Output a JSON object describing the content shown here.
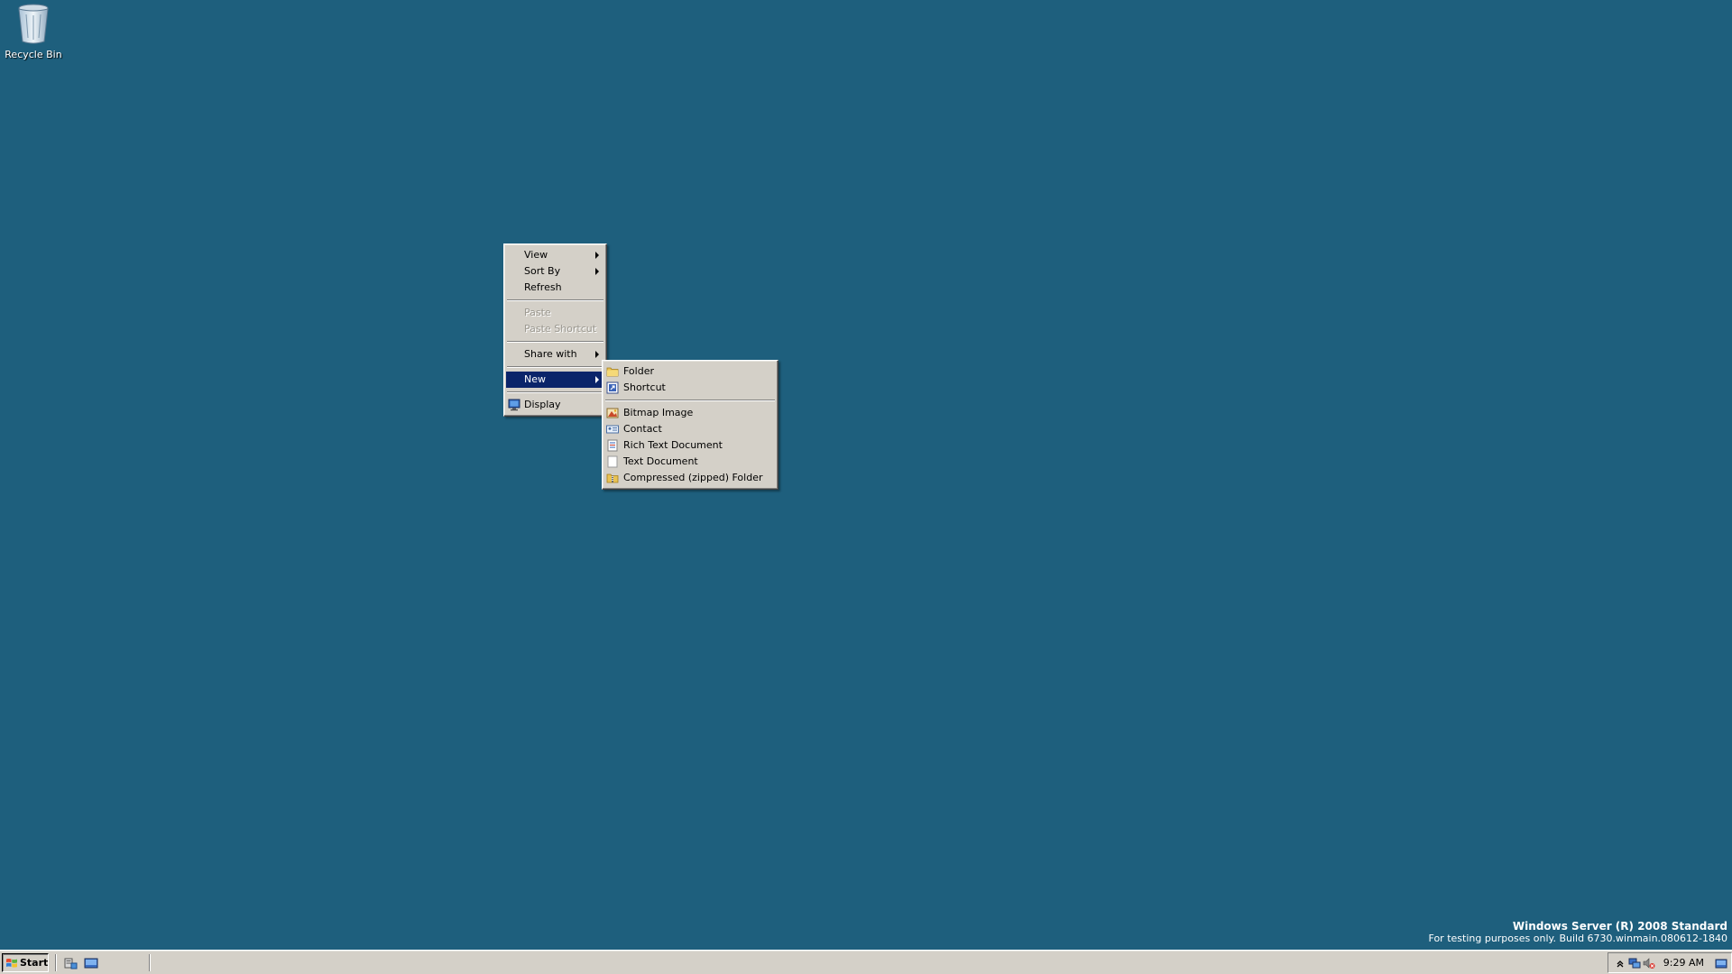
{
  "desktop": {
    "icons": [
      {
        "label": "Recycle Bin"
      }
    ]
  },
  "context_menu": {
    "items": [
      {
        "label": "View",
        "has_submenu": true
      },
      {
        "label": "Sort By",
        "has_submenu": true
      },
      {
        "label": "Refresh"
      },
      {
        "label": "Paste",
        "disabled": true
      },
      {
        "label": "Paste Shortcut",
        "disabled": true
      },
      {
        "label": "Share with",
        "has_submenu": true
      },
      {
        "label": "New",
        "has_submenu": true,
        "highlighted": true
      },
      {
        "label": "Display",
        "icon": "display-icon"
      }
    ]
  },
  "new_submenu": {
    "items": [
      {
        "label": "Folder",
        "icon": "folder-icon"
      },
      {
        "label": "Shortcut",
        "icon": "shortcut-icon"
      },
      {
        "label": "Bitmap Image",
        "icon": "bitmap-icon"
      },
      {
        "label": "Contact",
        "icon": "contact-icon"
      },
      {
        "label": "Rich Text Document",
        "icon": "rich-text-icon"
      },
      {
        "label": "Text Document",
        "icon": "text-document-icon"
      },
      {
        "label": "Compressed (zipped) Folder",
        "icon": "zipped-folder-icon"
      }
    ]
  },
  "watermark": {
    "line1": "Windows Server (R) 2008 Standard",
    "line2": "For testing purposes only. Build 6730.winmain.080612-1840"
  },
  "taskbar": {
    "start_label": "Start",
    "clock": "9:29 AM"
  },
  "colors": {
    "desktop": "#1e5f7d",
    "menu_bg": "#d4d0c8",
    "highlight": "#0a246a"
  }
}
